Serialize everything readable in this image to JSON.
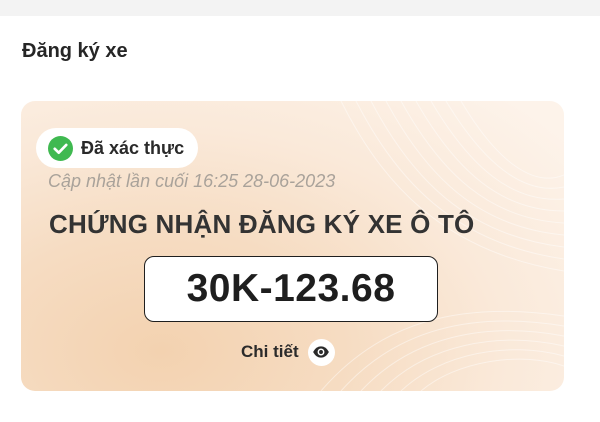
{
  "section": {
    "title": "Đăng ký xe"
  },
  "card": {
    "status_badge": {
      "label": "Đã xác thực",
      "icon": "check-circle-icon",
      "icon_color": "#3fb950"
    },
    "last_updated": "Cập nhật lần cuối 16:25 28-06-2023",
    "document_title": "CHỨNG NHẬN ĐĂNG KÝ XE Ô TÔ",
    "plate_number": "30K-123.68",
    "detail_link": {
      "label": "Chi tiết",
      "icon": "eye-icon"
    },
    "colors": {
      "gradient_warm": "#f3d2b0",
      "gradient_light": "#fdf3ea"
    }
  }
}
